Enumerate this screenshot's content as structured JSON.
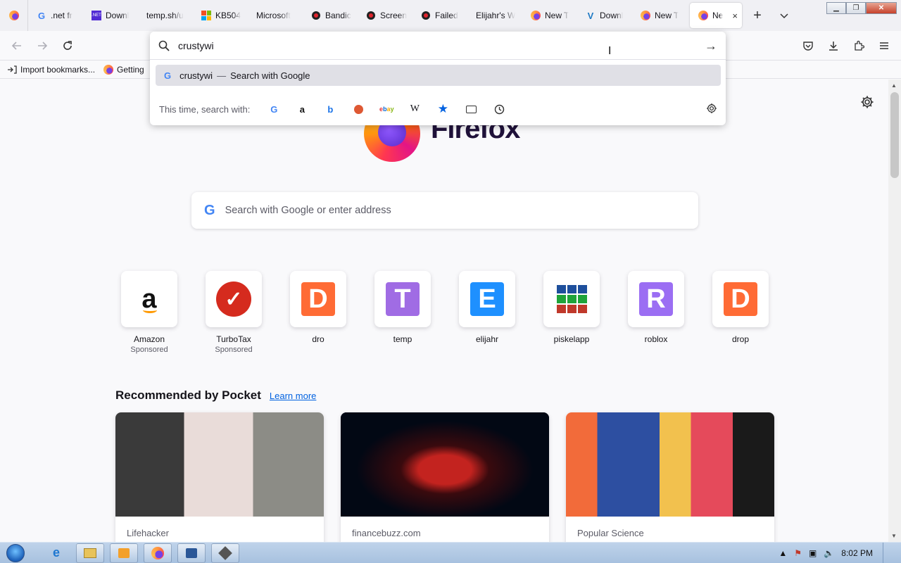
{
  "tabs": [
    {
      "label": ".net fr",
      "icon": "google-icon"
    },
    {
      "label": "Downl",
      "icon": "dotnet-icon"
    },
    {
      "label": "temp.sh/u",
      "icon": "none"
    },
    {
      "label": "KB504",
      "icon": "microsoft-icon"
    },
    {
      "label": "Microsoft",
      "icon": "none"
    },
    {
      "label": "Bandic",
      "icon": "record-icon"
    },
    {
      "label": "Screen",
      "icon": "record-icon"
    },
    {
      "label": "Failed",
      "icon": "record-icon"
    },
    {
      "label": "Elijahr's W",
      "icon": "none"
    },
    {
      "label": "New T",
      "icon": "firefox-icon"
    },
    {
      "label": "Downl",
      "icon": "v-icon"
    },
    {
      "label": "New T",
      "icon": "firefox-icon"
    }
  ],
  "active_tab": {
    "label": "Ne",
    "close": "×"
  },
  "new_tab_glyph": "+",
  "window_controls": {
    "minimize": "▁",
    "restore": "❐",
    "close": "✕"
  },
  "address_bar": {
    "value": "crustywi",
    "go_glyph": "→"
  },
  "suggestion": {
    "query": "crustywi",
    "separator": "—",
    "action": "Search with Google"
  },
  "one_off": {
    "label": "This time, search with:",
    "engines": [
      "google",
      "amazon",
      "bing",
      "duckduckgo",
      "ebay",
      "wikipedia",
      "bookmarks",
      "tabs",
      "history"
    ]
  },
  "bookmarks": [
    {
      "label": "Import bookmarks...",
      "icon": "import-icon"
    },
    {
      "label": "Getting",
      "icon": "firefox-icon"
    }
  ],
  "brand": {
    "wordmark": "Firefox"
  },
  "search": {
    "placeholder": "Search with Google or enter address"
  },
  "shortcuts": [
    {
      "title": "Amazon",
      "sub": "Sponsored",
      "tile": "amazon"
    },
    {
      "title": "TurboTax",
      "sub": "Sponsored",
      "tile": "turbotax"
    },
    {
      "title": "dro",
      "sub": "",
      "tile": "d"
    },
    {
      "title": "temp",
      "sub": "",
      "tile": "t"
    },
    {
      "title": "elijahr",
      "sub": "",
      "tile": "e"
    },
    {
      "title": "piskelapp",
      "sub": "",
      "tile": "grid"
    },
    {
      "title": "roblox",
      "sub": "",
      "tile": "r"
    },
    {
      "title": "drop",
      "sub": "",
      "tile": "d"
    }
  ],
  "pocket": {
    "heading": "Recommended by Pocket",
    "learn_more": "Learn more",
    "cards": [
      {
        "source": "Lifehacker"
      },
      {
        "source": "financebuzz.com"
      },
      {
        "source": "Popular Science"
      }
    ]
  },
  "taskbar": {
    "clock": "8:02 PM"
  },
  "colors": {
    "accent_blue": "#0061e0",
    "firefox_purple": "#7542e5",
    "firefox_orange": "#ff9640"
  }
}
